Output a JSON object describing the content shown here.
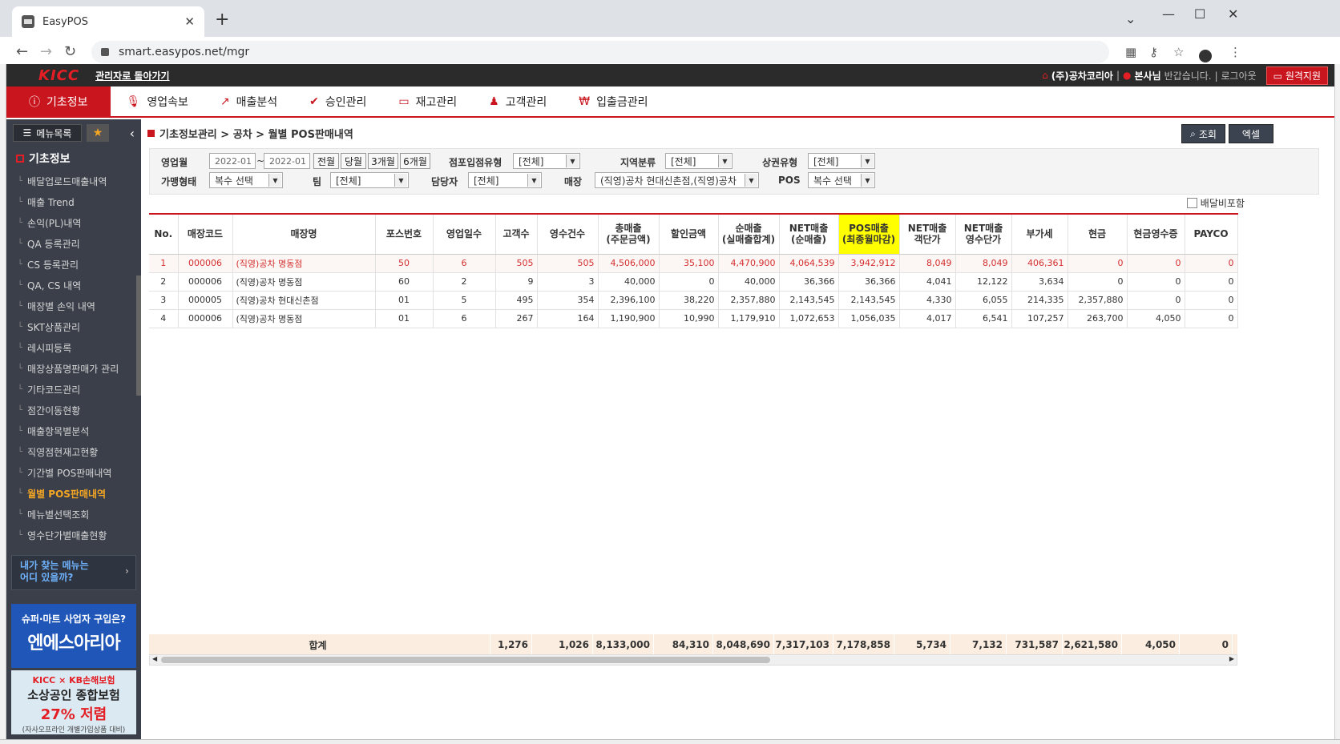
{
  "browser": {
    "tab_title": "EasyPOS",
    "url": "smart.easypos.net/mgr"
  },
  "topbar": {
    "logo": "KICC",
    "back_link": "관리자로 돌아가기",
    "company": "(주)공차코리아",
    "sep": "|",
    "user": "본사님",
    "greeting": "반갑습니다.",
    "logout": "| 로그아웃",
    "remote": "원격지원"
  },
  "menu": {
    "items": [
      {
        "label": "기초정보",
        "icon": "ⓘ"
      },
      {
        "label": "영업속보",
        "icon": "🎙"
      },
      {
        "label": "매출분석",
        "icon": "↗"
      },
      {
        "label": "승인관리",
        "icon": "✔"
      },
      {
        "label": "재고관리",
        "icon": "▭"
      },
      {
        "label": "고객관리",
        "icon": "♟"
      },
      {
        "label": "입출금관리",
        "icon": "₩"
      }
    ]
  },
  "sidebar": {
    "menu_list_btn": "메뉴목록",
    "star": "★",
    "collapse": "‹",
    "section_title": "기초정보",
    "items": [
      "배달업로드매출내역",
      "매출 Trend",
      "손익(PL)내역",
      "QA 등록관리",
      "CS 등록관리",
      "QA, CS 내역",
      "매장별 손익 내역",
      "SKT상품관리",
      "레시피등록",
      "매장상품명판매가 관리",
      "기타코드관리",
      "점간이동현황",
      "매출항목별분석",
      "직영점현재고현황",
      "기간별 POS판매내역",
      "월별 POS판매내역",
      "메뉴별선택조회",
      "영수단가별매출현황"
    ],
    "active_index": 15,
    "find_menu_line1": "내가 찾는 메뉴는",
    "find_menu_line2": "어디 있을까?",
    "ad1_line1": "슈퍼·마트 사업자 구입은?",
    "ad1_line2": "엔에스아리아",
    "ad2_line1": "KICC × KB손해보험",
    "ad2_line2": "소상공인 종합보험",
    "ad2_line3": "27% 저렴",
    "ad2_line4": "(자사오프라인 개별가입상품 대비)"
  },
  "breadcrumb": {
    "path": "기초정보관리 > 공차 > 월별 POS판매내역"
  },
  "actions": {
    "search": "조회",
    "excel": "엑셀"
  },
  "filters": {
    "business_month_label": "영업월",
    "from": "2022-01",
    "tilde": "~",
    "to": "2022-01",
    "btn_prev": "전월",
    "btn_curr": "당월",
    "btn_3m": "3개월",
    "btn_6m": "6개월",
    "store_type_label": "점포입점유형",
    "store_type": "[전체]",
    "region_label": "지역분류",
    "region": "[전체]",
    "commercial_label": "상권유형",
    "commercial": "[전체]",
    "franchise_label": "가맹형태",
    "franchise": "복수 선택",
    "team_label": "팀",
    "team": "[전체]",
    "manager_label": "담당자",
    "manager": "[전체]",
    "store_label": "매장",
    "store": "(직영)공차 현대신촌점,(직영)공차",
    "pos_label": "POS",
    "pos": "복수 선택",
    "delivery_label": "배달비포함"
  },
  "table": {
    "headers": [
      "No.",
      "매장코드",
      "매장명",
      "포스번호",
      "영업일수",
      "고객수",
      "영수건수",
      "총매출\n(주문금액)",
      "할인금액",
      "순매출\n(실매출합계)",
      "NET매출\n(순매출)",
      "POS매출\n(최종월마감)",
      "NET매출\n객단가",
      "NET매출\n영수단가",
      "부가세",
      "현금",
      "현금영수증",
      "PAYCO"
    ],
    "rows": [
      [
        "1",
        "000006",
        "(직영)공차 명동점",
        "50",
        "6",
        "505",
        "505",
        "4,506,000",
        "35,100",
        "4,470,900",
        "4,064,539",
        "3,942,912",
        "8,049",
        "8,049",
        "406,361",
        "0",
        "0",
        "0"
      ],
      [
        "2",
        "000006",
        "(직영)공차 명동점",
        "60",
        "2",
        "9",
        "3",
        "40,000",
        "0",
        "40,000",
        "36,366",
        "36,366",
        "4,041",
        "12,122",
        "3,634",
        "0",
        "0",
        "0"
      ],
      [
        "3",
        "000005",
        "(직영)공차 현대신촌점",
        "01",
        "5",
        "495",
        "354",
        "2,396,100",
        "38,220",
        "2,357,880",
        "2,143,545",
        "2,143,545",
        "4,330",
        "6,055",
        "214,335",
        "2,357,880",
        "0",
        "0"
      ],
      [
        "4",
        "000006",
        "(직영)공차 명동점",
        "01",
        "6",
        "267",
        "164",
        "1,190,900",
        "10,990",
        "1,179,910",
        "1,072,653",
        "1,056,035",
        "4,017",
        "6,541",
        "107,257",
        "263,700",
        "4,050",
        "0"
      ]
    ],
    "totals_label": "합계",
    "totals": [
      "1,276",
      "1,026",
      "8,133,000",
      "84,310",
      "8,048,690",
      "7,317,103",
      "7,178,858",
      "5,734",
      "7,132",
      "731,587",
      "2,621,580",
      "4,050",
      "0"
    ]
  }
}
